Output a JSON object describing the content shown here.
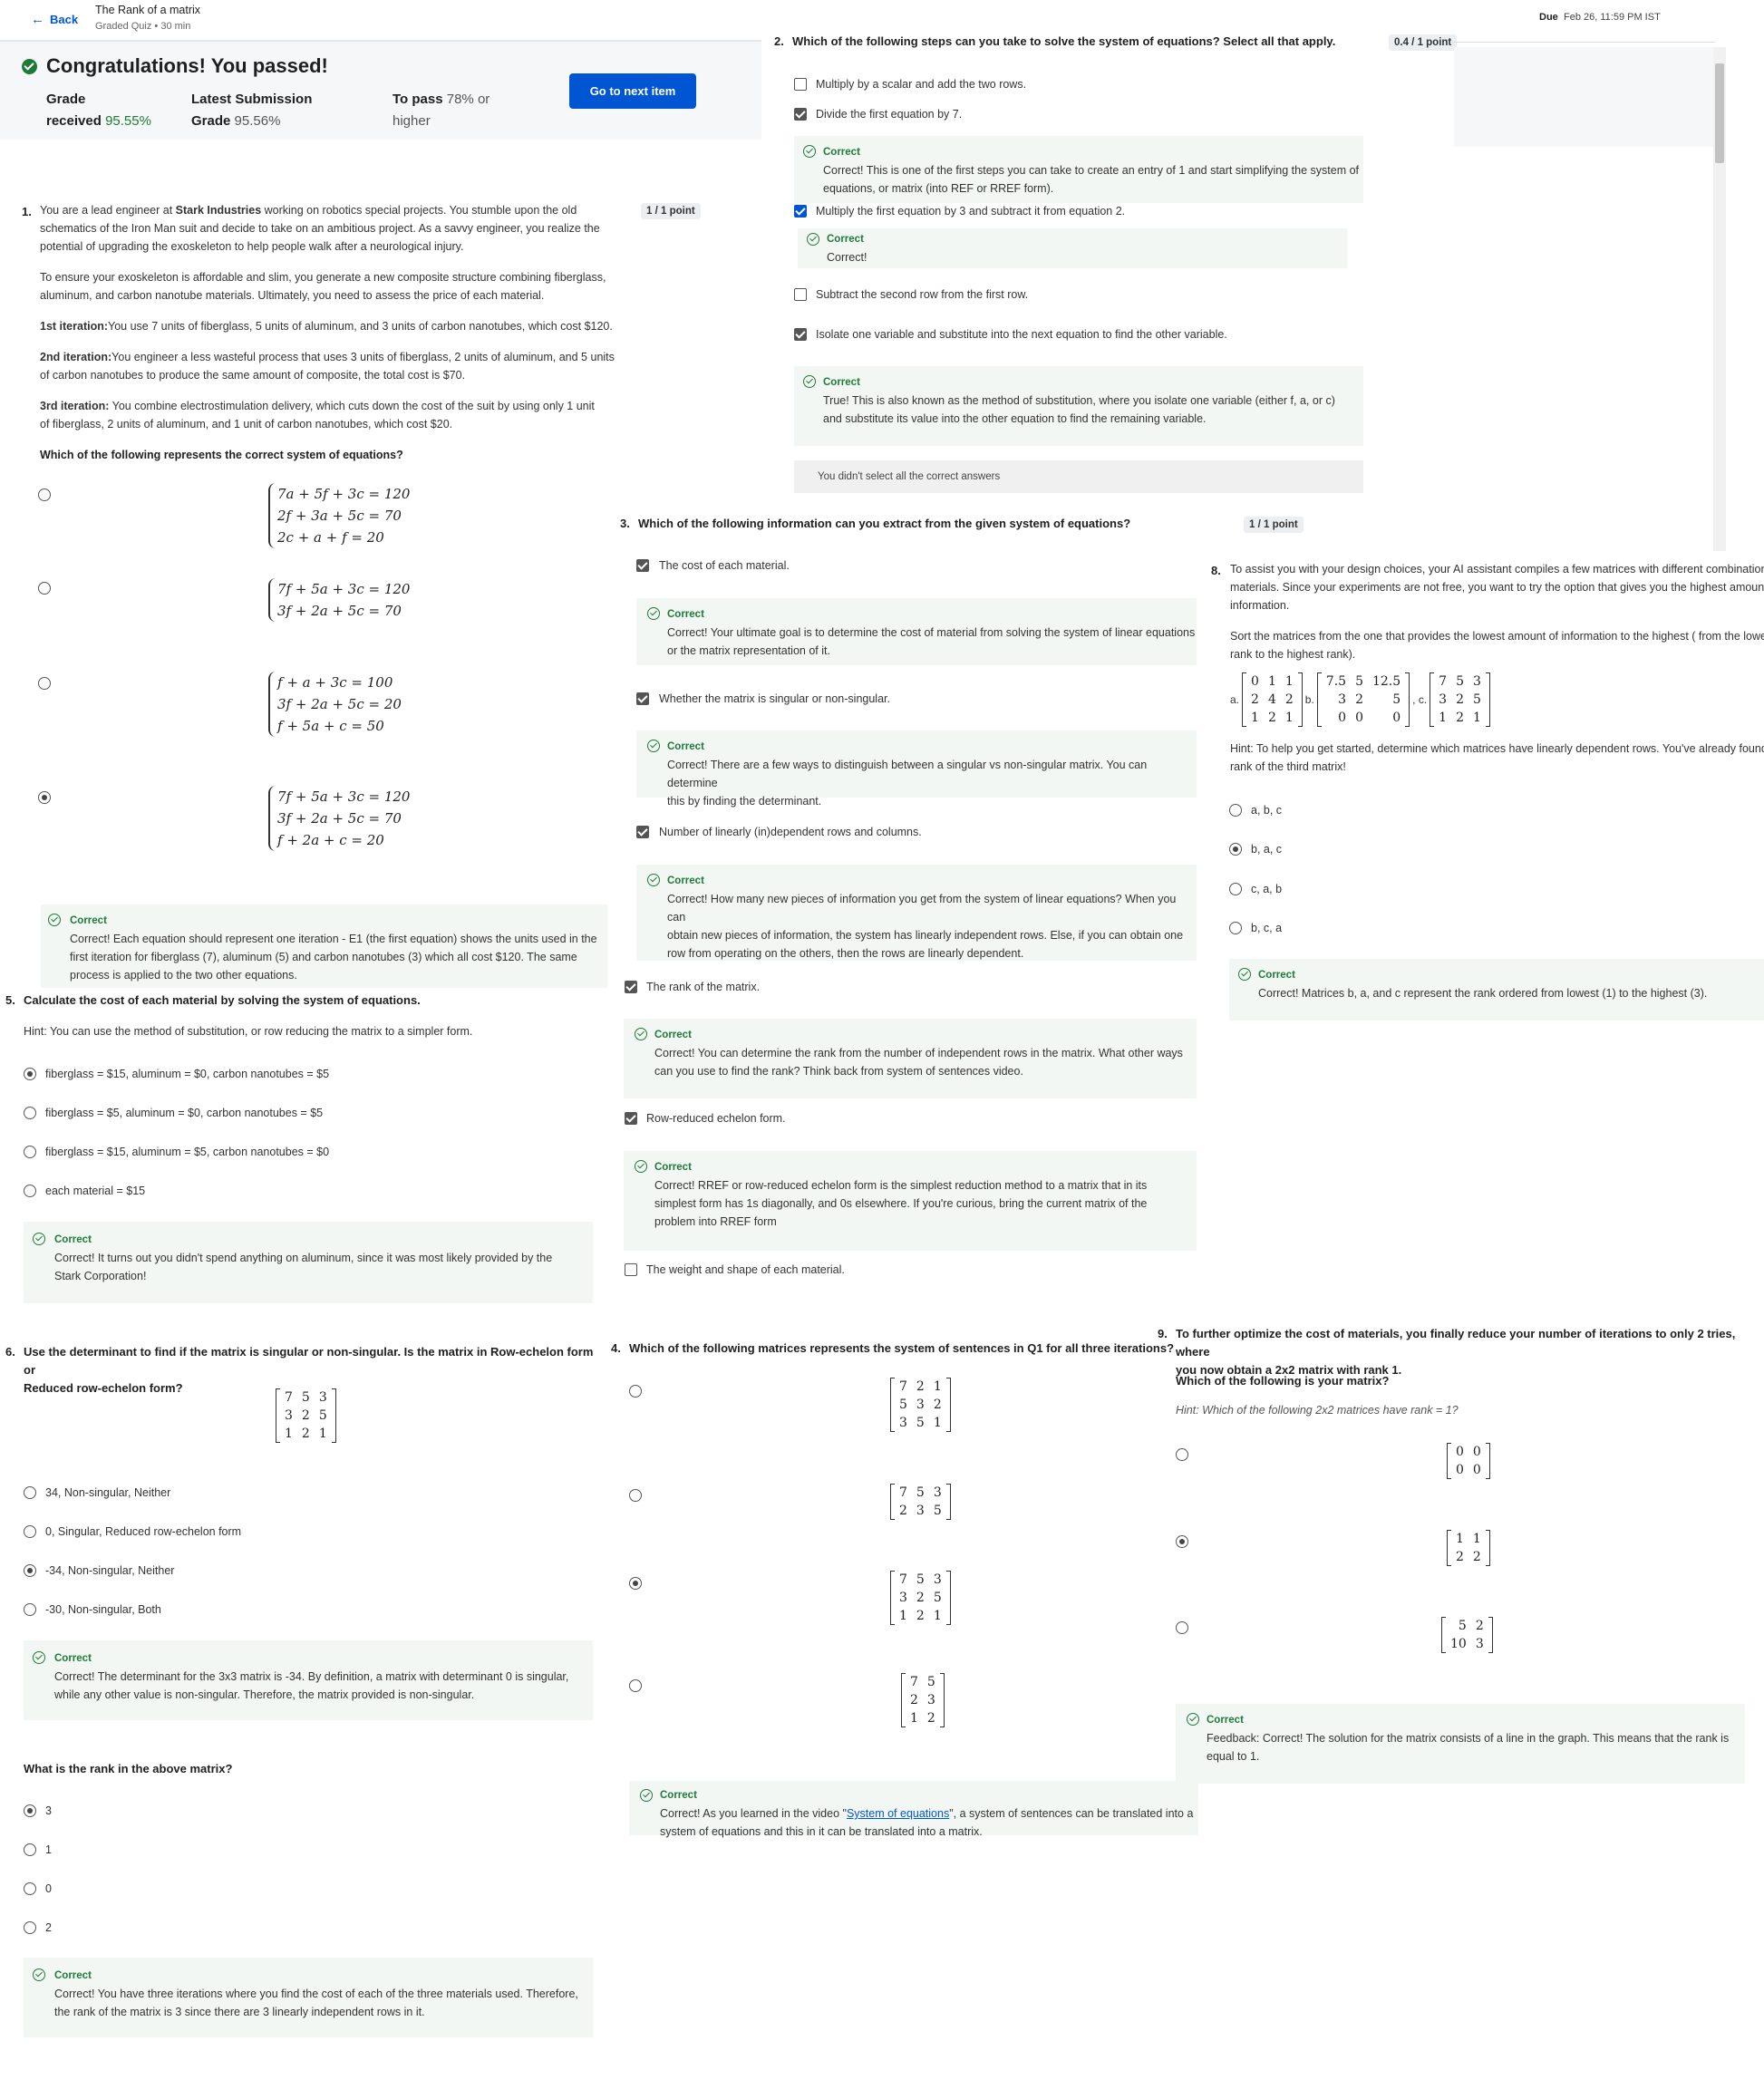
{
  "header": {
    "back_label": "Back",
    "title": "The Rank of a matrix",
    "subtitle": "Graded Quiz • 30 min",
    "due_label": "Due",
    "due_value": "Feb 26, 11:59 PM IST"
  },
  "banner": {
    "headline": "Congratulations! You passed!",
    "grade_label_1": "Grade",
    "grade_label_2": "received",
    "grade_value": "95.55%",
    "latest_label_1": "Latest Submission",
    "latest_label_2": "Grade",
    "latest_value": "95.56%",
    "pass_label_1": "To pass",
    "pass_value": "78% or",
    "pass_label_2": "higher",
    "next_button": "Go to next item"
  },
  "q1": {
    "num": "1.",
    "points": "1 / 1 point",
    "p1a": "You are a lead engineer at ",
    "p1b": "Stark Industries",
    "p1c": " working on robotics special projects. You stumble upon the old",
    "p1d": "schematics of the Iron Man suit and decide to take on an ambitious project. As a savvy engineer, you realize the",
    "p1e": "potential of upgrading the exoskeleton to help people walk after a neurological injury.",
    "p2a": "To ensure your exoskeleton is affordable and slim, you generate a new composite structure combining fiberglass,",
    "p2b": "aluminum, and carbon nanotube materials. Ultimately, you need to assess the price of each material.",
    "it1_label": "1st iteration:",
    "it1_text": "You use 7 units of fiberglass, 5 units of aluminum, and 3 units of carbon nanotubes, which cost $120.",
    "it2_label": "2nd iteration:",
    "it2_text_a": "You engineer a less wasteful process that uses 3 units of fiberglass, 2 units of aluminum, and 5 units",
    "it2_text_b": "of carbon nanotubes to produce the same amount of composite, the total cost is $70.",
    "it3_label": "3rd iteration:",
    "it3_text_a": " You combine electrostimulation delivery, which cuts down the cost of the suit by using only 1 unit",
    "it3_text_b": "of fiberglass, 2 units of aluminum, and 1 unit of carbon nanotubes, which cost $20.",
    "prompt": "Which of the following represents the correct system of equations?",
    "opt1": [
      "7a + 5f + 3c = 120",
      "2f + 3a + 5c = 70",
      "2c + a + f = 20"
    ],
    "opt2": [
      "7f + 5a + 3c = 120",
      "3f + 2a + 5c = 70"
    ],
    "opt3": [
      "f + a + 3c = 100",
      "3f + 2a + 5c = 20",
      "f + 5a + c = 50"
    ],
    "opt4": [
      "7f + 5a + 3c = 120",
      "3f + 2a + 5c = 70",
      "f + 2a + c = 20"
    ],
    "fb_label": "Correct",
    "fb_1": "Correct! Each equation should represent one iteration - E1 (the first equation) shows the units used in the",
    "fb_2": "first iteration for fiberglass (7), aluminum (5) and carbon nanotubes (3) which all cost $120. The same",
    "fb_3": "process is applied to the two other equations."
  },
  "q5": {
    "num": "5.",
    "prompt": "Calculate the cost of each material by solving the system of equations.",
    "hint": "Hint: You can use the method of substitution, or row reducing the matrix to a simpler form.",
    "options": [
      "fiberglass = $15, aluminum = $0, carbon nanotubes = $5",
      "fiberglass = $5, aluminum = $0, carbon nanotubes = $5",
      "fiberglass = $15, aluminum = $5, carbon nanotubes = $0",
      "each material = $15"
    ],
    "fb_label": "Correct",
    "fb_1": "Correct! It turns out you didn't spend anything on aluminum, since it was most likely provided by the",
    "fb_2": "Stark Corporation!"
  },
  "q6": {
    "num": "6.",
    "prompt_1": "Use the determinant to find if the matrix is singular or non-singular. Is the matrix in Row-echelon form or",
    "prompt_2": "Reduced row-echelon form?",
    "matrix": [
      [
        "7",
        "5",
        "3"
      ],
      [
        "3",
        "2",
        "5"
      ],
      [
        "1",
        "2",
        "1"
      ]
    ],
    "options": [
      "34, Non-singular, Neither",
      "0, Singular, Reduced row-echelon form",
      "-34, Non-singular, Neither",
      "-30, Non-singular, Both"
    ],
    "fb_label": "Correct",
    "fb_1": "Correct! The determinant for the 3x3 matrix is -34. By definition, a matrix with determinant 0 is singular,",
    "fb_2": "while any other value is non-singular. Therefore, the matrix provided is non-singular.",
    "rank_prompt": "What is the rank in the above matrix?",
    "rank_options": [
      "3",
      "1",
      "0",
      "2"
    ],
    "rank_fb_label": "Correct",
    "rank_fb_1": "Correct! You have three iterations where you find the cost of each of the three materials used. Therefore,",
    "rank_fb_2": "the rank of the matrix is 3 since there are 3 linearly independent rows in it."
  },
  "q2": {
    "num": "2.",
    "prompt": "Which of the following steps can you take to solve the system of equations? Select all that apply.",
    "points": "0.4 / 1 point",
    "opt1": "Multiply by a scalar and add the two rows.",
    "opt2": "Divide the first equation by 7.",
    "fb2_label": "Correct",
    "fb2_1": "Correct! This is one of the first steps you can take to create an entry of 1 and start simplifying the system of",
    "fb2_2": "equations, or matrix (into REF or RREF form).",
    "opt3": "Multiply the first equation by 3 and subtract it from equation 2.",
    "fb3_label": "Correct",
    "fb3_1": "Correct!",
    "opt4": "Subtract the second row from the first row.",
    "opt5": "Isolate one variable and substitute into the next equation to find the other variable.",
    "fb5_label": "Correct",
    "fb5_1": "True! This is also known as the method of substitution, where you isolate one variable (either f, a, or c)",
    "fb5_2": "and substitute its value into the other equation to find the remaining variable.",
    "warning": "You didn't select all the correct answers"
  },
  "q3": {
    "num": "3.",
    "prompt": "Which of the following information can you extract from the given system of equations?",
    "points": "1 / 1 point",
    "opt1": "The cost of each material.",
    "fb1_label": "Correct",
    "fb1_1": "Correct! Your ultimate goal is to determine the cost of material from solving the system of linear equations",
    "fb1_2": "or the matrix representation of it.",
    "opt2": "Whether the matrix is singular or non-singular.",
    "fb2_label": "Correct",
    "fb2_1": "Correct! There are a few ways to distinguish between a singular vs non-singular matrix. You can determine",
    "fb2_2": "this by finding the determinant.",
    "opt3": "Number of linearly (in)dependent rows and columns.",
    "fb3_label": "Correct",
    "fb3_1": "Correct! How many new pieces of information you get from the system of linear equations? When you can",
    "fb3_2": "obtain new pieces of information, the system has linearly independent rows. Else, if you can obtain one",
    "fb3_3": "row from operating on the others, then the rows are linearly dependent.",
    "opt4": "The rank of the matrix.",
    "fb4_label": "Correct",
    "fb4_1": "Correct! You can determine the rank from the number of independent rows in the matrix. What other ways",
    "fb4_2": "can you use to find the rank? Think back from system of sentences video.",
    "opt5": "Row-reduced echelon form.",
    "fb5_label": "Correct",
    "fb5_1": "Correct! RREF or row-reduced echelon form is the simplest reduction method to a matrix that in its",
    "fb5_2": "simplest form has 1s diagonally, and 0s elsewhere. If you're curious, bring the current matrix of the",
    "fb5_3": "problem into RREF form",
    "opt6": "The weight and shape of each material."
  },
  "q4": {
    "num": "4.",
    "prompt": "Which of the following matrices represents the system of sentences in Q1 for all three iterations?",
    "m1": [
      [
        "7",
        "2",
        "1"
      ],
      [
        "5",
        "3",
        "2"
      ],
      [
        "3",
        "5",
        "1"
      ]
    ],
    "m2": [
      [
        "7",
        "5",
        "3"
      ],
      [
        "2",
        "3",
        "5"
      ]
    ],
    "m3": [
      [
        "7",
        "5",
        "3"
      ],
      [
        "3",
        "2",
        "5"
      ],
      [
        "1",
        "2",
        "1"
      ]
    ],
    "m4": [
      [
        "7",
        "5"
      ],
      [
        "2",
        "3"
      ],
      [
        "1",
        "2"
      ]
    ],
    "fb_label": "Correct",
    "fb_1a": "Correct! As you learned in the video \"",
    "fb_link": "System of equations",
    "fb_1b": "\", a system of sentences can be translated into a",
    "fb_2": "system of equations and this in it can be translated into a matrix."
  },
  "q8": {
    "num": "8.",
    "p1": "To assist you with your design choices, your AI assistant compiles a few matrices with different combinations",
    "p2": "materials. Since your experiments are not free, you want to try the option that gives you the highest amount",
    "p3": "information.",
    "p4": "Sort the matrices from the one that provides the lowest amount of information to the highest ( from the lowest",
    "p5": "rank to the highest rank).",
    "label_a": "a.",
    "label_b": "b.",
    "label_c": ", c.",
    "ma": [
      [
        "0",
        "1",
        "1"
      ],
      [
        "2",
        "4",
        "2"
      ],
      [
        "1",
        "2",
        "1"
      ]
    ],
    "mb": [
      [
        "7.5",
        "5",
        "12.5"
      ],
      [
        "3",
        "2",
        "5"
      ],
      [
        "0",
        "0",
        "0"
      ]
    ],
    "mc": [
      [
        "7",
        "5",
        "3"
      ],
      [
        "3",
        "2",
        "5"
      ],
      [
        "1",
        "2",
        "1"
      ]
    ],
    "hint_1": "Hint: To help you get started, determine which matrices have linearly dependent rows. You've already found",
    "hint_2": "rank of the third matrix!",
    "options": [
      "a, b, c",
      "b, a, c",
      "c, a, b",
      "b, c, a"
    ],
    "fb_label": "Correct",
    "fb_1": "Correct! Matrices b, a, and c represent the rank ordered from lowest (1) to the highest (3)."
  },
  "q9": {
    "num": "9.",
    "prompt_1": "To further optimize the cost of materials, you finally reduce your number of iterations to only 2 tries, where",
    "prompt_2": "you now obtain a 2x2 matrix with rank 1.",
    "sub": "Which of the following is your matrix?",
    "hint": "Hint: Which of the following 2x2 matrices have rank  = 1?",
    "m1": [
      [
        "0",
        "0"
      ],
      [
        "0",
        "0"
      ]
    ],
    "m2": [
      [
        "1",
        "1"
      ],
      [
        "2",
        "2"
      ]
    ],
    "m3": [
      [
        "5",
        "2"
      ],
      [
        "10",
        "3"
      ]
    ],
    "fb_label": "Correct",
    "fb_1": "Feedback: Correct! The solution for the matrix consists of a line in the graph. This means that the rank is",
    "fb_2": "equal to 1."
  }
}
